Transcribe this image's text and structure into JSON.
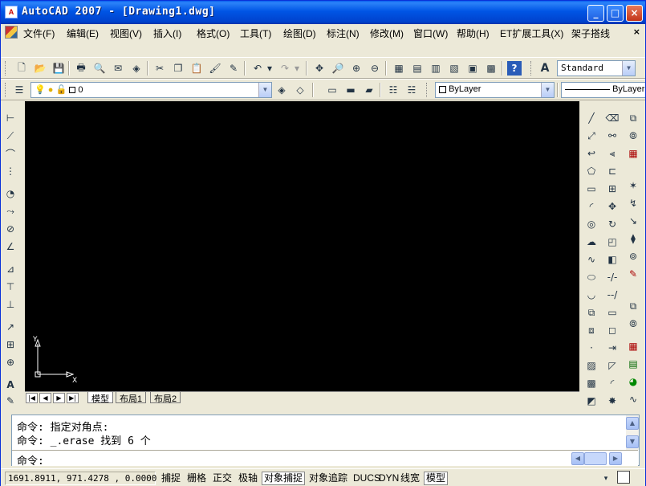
{
  "window": {
    "title": "AutoCAD 2007 - [Drawing1.dwg]",
    "app_icon_label": "A",
    "minimize": "_",
    "maximize": "□",
    "close": "×"
  },
  "menu": {
    "items": [
      "文件(F)",
      "编辑(E)",
      "视图(V)",
      "插入(I)",
      "格式(O)",
      "工具(T)",
      "绘图(D)",
      "标注(N)",
      "修改(M)",
      "窗口(W)",
      "帮助(H)",
      "ET扩展工具(X)",
      "架子搭线"
    ],
    "close_glyph": "×"
  },
  "standard_toolbar": {
    "icons": [
      "new-icon",
      "open-icon",
      "save-icon",
      "plot-icon",
      "plot-preview-icon",
      "publish-icon",
      "3d-dwf-icon",
      "cut-icon",
      "copy-icon",
      "paste-icon",
      "match-properties-icon",
      "block-editor-icon",
      "undo-icon",
      "redo-icon",
      "pan-icon",
      "zoom-realtime-icon",
      "zoom-window-icon",
      "zoom-previous-icon",
      "properties-icon",
      "design-center-icon",
      "tool-palettes-icon",
      "sheet-set-icon",
      "markup-icon",
      "quickcalc-icon",
      "help-icon",
      "text-style-icon"
    ],
    "text_style": "Standard"
  },
  "layers_toolbar": {
    "current_layer": "0",
    "color": "ByLayer",
    "linetype": "ByLayer"
  },
  "canvas": {
    "background": "#000000",
    "ucs_x_label": "X",
    "ucs_y_label": "Y"
  },
  "layout_tabs": {
    "nav": [
      "|◀",
      "◀",
      "▶",
      "▶|"
    ],
    "tabs": [
      {
        "label": "模型",
        "active": true
      },
      {
        "label": "布局1",
        "active": false
      },
      {
        "label": "布局2",
        "active": false
      }
    ]
  },
  "command": {
    "history": [
      "命令: 指定对角点:",
      "命令: _.erase 找到 6 个"
    ],
    "prompt": "命令:"
  },
  "status": {
    "coordinates": "1691.8911, 971.4278 , 0.0000",
    "toggles": [
      {
        "label": "捕捉",
        "on": false
      },
      {
        "label": "栅格",
        "on": false
      },
      {
        "label": "正交",
        "on": false
      },
      {
        "label": "极轴",
        "on": false
      },
      {
        "label": "对象捕捉",
        "on": true
      },
      {
        "label": "对象追踪",
        "on": false
      },
      {
        "label": "DUCS",
        "on": false
      },
      {
        "label": "DYN",
        "on": false
      },
      {
        "label": "线宽",
        "on": false
      },
      {
        "label": "模型",
        "on": true
      }
    ]
  },
  "left_toolbar": {
    "icons": [
      "dim-linear-icon",
      "dim-aligned-icon",
      "dim-arc-icon",
      "dim-ordinate-icon",
      "dim-radius-icon",
      "dim-jogged-icon",
      "dim-diameter-icon",
      "dim-angular-icon",
      "quick-dim-icon",
      "dim-baseline-icon",
      "dim-continue-icon",
      "quick-leader-icon",
      "tolerance-icon",
      "center-mark-icon",
      "dim-edit-icon",
      "dim-text-edit-icon"
    ]
  },
  "draw_toolbar": {
    "icons": [
      "line-icon",
      "construction-line-icon",
      "polyline-icon",
      "polygon-icon",
      "rectangle-icon",
      "arc-icon",
      "circle-icon",
      "revcloud-icon",
      "spline-icon",
      "ellipse-icon",
      "ellipse-arc-icon",
      "insert-block-icon",
      "make-block-icon",
      "point-icon",
      "hatch-icon",
      "gradient-icon",
      "region-icon",
      "table-icon",
      "mtext-icon"
    ]
  },
  "modify_toolbar": {
    "icons": [
      "erase-icon",
      "copy-object-icon",
      "mirror-icon",
      "offset-icon",
      "array-icon",
      "move-icon",
      "rotate-icon",
      "scale-icon",
      "stretch-icon",
      "trim-icon",
      "extend-icon",
      "break-at-point-icon",
      "break-icon",
      "join-icon",
      "chamfer-icon",
      "fillet-icon",
      "explode-icon"
    ]
  },
  "right_toolbar": {
    "icons": [
      "et-tool-1-icon",
      "et-tool-2-icon",
      "et-tool-3-icon",
      "et-tool-4-icon",
      "et-tool-5-icon",
      "et-tool-6-icon",
      "et-tool-7-icon",
      "et-tool-8-icon",
      "et-tool-9-icon",
      "et-tool-10-icon",
      "et-tool-11-icon",
      "et-tool-12-icon",
      "et-tool-13-icon",
      "et-tool-14-icon",
      "et-tool-15-icon",
      "et-tool-16-icon"
    ]
  }
}
